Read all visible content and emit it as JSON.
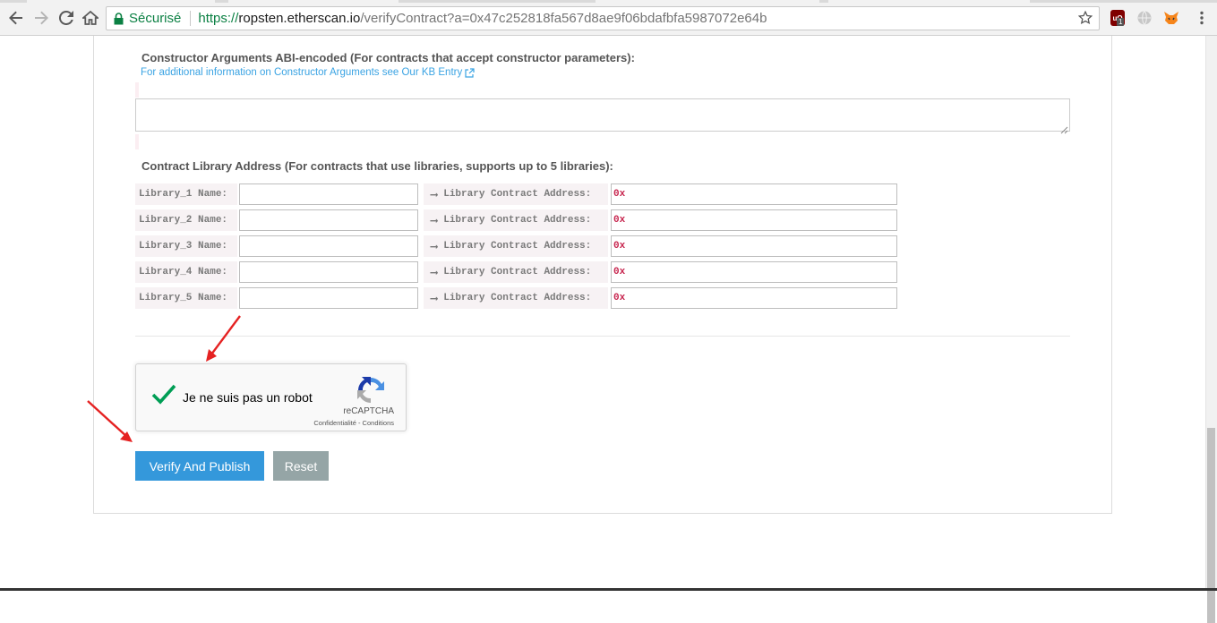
{
  "browser": {
    "secure_label": "Sécurisé",
    "url_scheme": "https://",
    "url_host": "ropsten.etherscan.io",
    "url_rest": "/verifyContract?a=0x47c252818fa567d8ae9f06bdafbfa5987072e64b",
    "ublock_badge": "1"
  },
  "constructor": {
    "title": "Constructor Arguments ABI-encoded (For contracts that accept constructor parameters):",
    "kb_link": "For additional information on Constructor Arguments see Our KB Entry",
    "value": ""
  },
  "libraries": {
    "title": "Contract Library Address (For contracts that use libraries, supports up to 5 libraries):",
    "address_label": "Library Contract Address:",
    "rows": [
      {
        "name_label": "Library_1 Name:",
        "name_value": "",
        "address_value": "0x"
      },
      {
        "name_label": "Library_2 Name:",
        "name_value": "",
        "address_value": "0x"
      },
      {
        "name_label": "Library_3 Name:",
        "name_value": "",
        "address_value": "0x"
      },
      {
        "name_label": "Library_4 Name:",
        "name_value": "",
        "address_value": "0x"
      },
      {
        "name_label": "Library_5 Name:",
        "name_value": "",
        "address_value": "0x"
      }
    ]
  },
  "recaptcha": {
    "label": "Je ne suis pas un robot",
    "brand": "reCAPTCHA",
    "links": "Confidentialité - Conditions",
    "checked": true
  },
  "actions": {
    "verify_label": "Verify And Publish",
    "reset_label": "Reset"
  },
  "colors": {
    "primary": "#3498db",
    "secondary": "#95a5a6",
    "link": "#3aa3e3",
    "code": "#c7254e",
    "check": "#009e55",
    "annotation_arrow": "#e52222"
  }
}
